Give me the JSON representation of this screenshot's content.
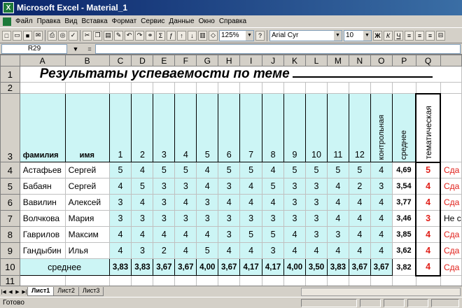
{
  "window": {
    "title": "Microsoft Excel - Material_1"
  },
  "menu": [
    "Файл",
    "Правка",
    "Вид",
    "Вставка",
    "Формат",
    "Сервис",
    "Данные",
    "Окно",
    "Справка"
  ],
  "toolbar": {
    "zoom": "125%",
    "font": "Arial Cyr",
    "size": "10"
  },
  "formula_bar": {
    "cell": "R29",
    "value": ""
  },
  "columns": [
    "A",
    "B",
    "C",
    "D",
    "E",
    "F",
    "G",
    "H",
    "I",
    "J",
    "K",
    "L",
    "M",
    "N",
    "O",
    "P",
    "Q"
  ],
  "sheet": {
    "title": "Результаты успеваемости  по теме",
    "col_header_a": "фамилия",
    "col_header_b": "имя",
    "numbers": [
      "1",
      "2",
      "3",
      "4",
      "5",
      "6",
      "7",
      "8",
      "9",
      "10",
      "11",
      "12"
    ],
    "control": "контрольная",
    "average": "среднее",
    "thematic": "тематическая",
    "students": [
      {
        "last": "Астафьев",
        "first": "Сергей",
        "grades": [
          "5",
          "4",
          "5",
          "5",
          "4",
          "5",
          "5",
          "4",
          "5",
          "5",
          "5",
          "5"
        ],
        "control": "4",
        "avg": "4,69",
        "final": "5",
        "note": "Сда"
      },
      {
        "last": "Бабаян",
        "first": "Сергей",
        "grades": [
          "4",
          "5",
          "3",
          "3",
          "4",
          "3",
          "4",
          "5",
          "3",
          "3",
          "4",
          "2"
        ],
        "control": "3",
        "avg": "3,54",
        "final": "4",
        "note": "Сда"
      },
      {
        "last": "Вавилин",
        "first": "Алексей",
        "grades": [
          "3",
          "4",
          "3",
          "4",
          "3",
          "4",
          "4",
          "4",
          "3",
          "3",
          "4",
          "4"
        ],
        "control": "4",
        "avg": "3,77",
        "final": "4",
        "note": "Сда"
      },
      {
        "last": "Волчкова",
        "first": "Мария",
        "grades": [
          "3",
          "3",
          "3",
          "3",
          "3",
          "3",
          "3",
          "3",
          "3",
          "3",
          "4",
          "4"
        ],
        "control": "4",
        "avg": "3,46",
        "final": "3",
        "note": "Не с"
      },
      {
        "last": "Гаврилов",
        "first": "Максим",
        "grades": [
          "4",
          "4",
          "4",
          "4",
          "4",
          "3",
          "5",
          "5",
          "4",
          "3",
          "3",
          "4"
        ],
        "control": "4",
        "avg": "3,85",
        "final": "4",
        "note": "Сда"
      },
      {
        "last": "Гандыбин",
        "first": "Илья",
        "grades": [
          "4",
          "3",
          "2",
          "4",
          "5",
          "4",
          "4",
          "3",
          "4",
          "4",
          "4",
          "4"
        ],
        "control": "4",
        "avg": "3,62",
        "final": "4",
        "note": "Сда"
      }
    ],
    "average_row": {
      "label": "среднее",
      "values": [
        "3,83",
        "3,83",
        "3,67",
        "3,67",
        "4,00",
        "3,67",
        "4,17",
        "4,17",
        "4,00",
        "3,50",
        "3,83",
        "3,67",
        "3,67"
      ],
      "avg": "3,82",
      "final": "4",
      "note": "Сда"
    }
  },
  "sheet_tabs": [
    "Лист1",
    "Лист2",
    "Лист3"
  ],
  "status": "Готово"
}
